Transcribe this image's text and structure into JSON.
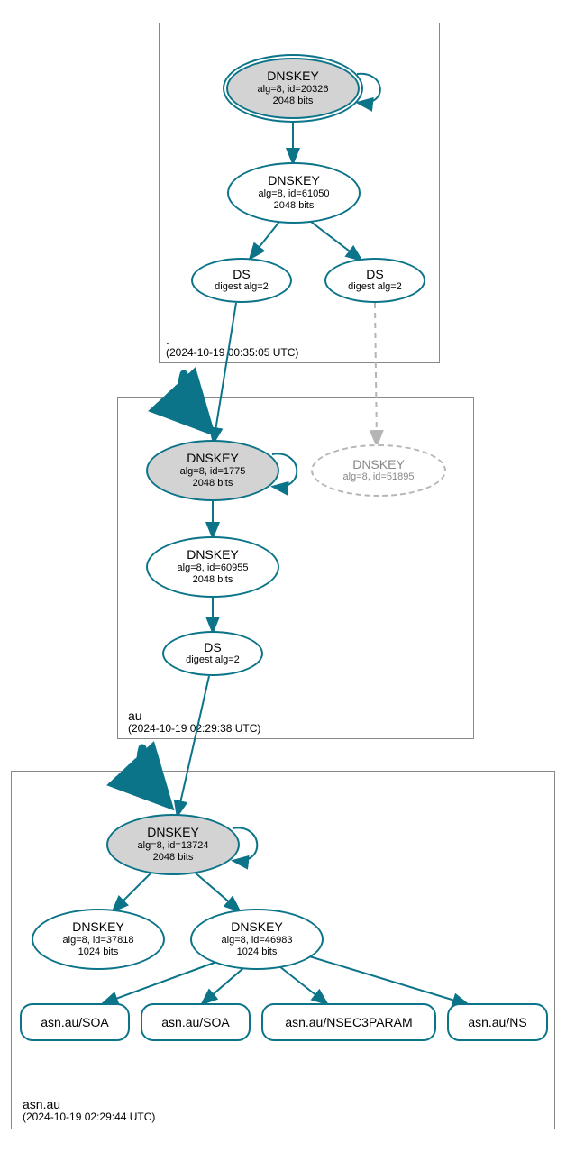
{
  "chart_data": {
    "type": "dag",
    "zones": [
      {
        "name": ".",
        "timestamp": "(2024-10-19 00:35:05 UTC)"
      },
      {
        "name": "au",
        "timestamp": "(2024-10-19 02:29:38 UTC)"
      },
      {
        "name": "asn.au",
        "timestamp": "(2024-10-19 02:29:44 UTC)"
      }
    ],
    "nodes": {
      "root_ksk": {
        "type": "DNSKEY",
        "detail": "alg=8, id=20326",
        "bits": "2048 bits",
        "ksk": true,
        "trust_anchor": true
      },
      "root_zsk": {
        "type": "DNSKEY",
        "detail": "alg=8, id=61050",
        "bits": "2048 bits"
      },
      "root_ds1": {
        "type": "DS",
        "detail": "digest alg=2"
      },
      "root_ds2": {
        "type": "DS",
        "detail": "digest alg=2"
      },
      "au_ksk": {
        "type": "DNSKEY",
        "detail": "alg=8, id=1775",
        "bits": "2048 bits",
        "ksk": true
      },
      "au_zsk": {
        "type": "DNSKEY",
        "detail": "alg=8, id=60955",
        "bits": "2048 bits"
      },
      "au_pre": {
        "type": "DNSKEY",
        "detail": "alg=8, id=51895",
        "dashed": true
      },
      "au_ds": {
        "type": "DS",
        "detail": "digest alg=2"
      },
      "asn_ksk": {
        "type": "DNSKEY",
        "detail": "alg=8, id=13724",
        "bits": "2048 bits",
        "ksk": true
      },
      "asn_zsk1": {
        "type": "DNSKEY",
        "detail": "alg=8, id=37818",
        "bits": "1024 bits"
      },
      "asn_zsk2": {
        "type": "DNSKEY",
        "detail": "alg=8, id=46983",
        "bits": "1024 bits"
      },
      "rr_soa1": {
        "type": "RR",
        "label": "asn.au/SOA"
      },
      "rr_soa2": {
        "type": "RR",
        "label": "asn.au/SOA"
      },
      "rr_nsec3": {
        "type": "RR",
        "label": "asn.au/NSEC3PARAM"
      },
      "rr_ns": {
        "type": "RR",
        "label": "asn.au/NS"
      }
    },
    "edges": [
      [
        "root_ksk",
        "root_ksk",
        "self"
      ],
      [
        "root_ksk",
        "root_zsk",
        "solid"
      ],
      [
        "root_zsk",
        "root_ds1",
        "solid"
      ],
      [
        "root_zsk",
        "root_ds2",
        "solid"
      ],
      [
        "root_ds1",
        "au_ksk",
        "solid"
      ],
      [
        "root_ds2",
        "au_pre",
        "dashed-gray"
      ],
      [
        "au_ksk",
        "au_ksk",
        "self"
      ],
      [
        "au_ksk",
        "au_zsk",
        "solid"
      ],
      [
        "au_zsk",
        "au_ds",
        "solid"
      ],
      [
        "au_ds",
        "asn_ksk",
        "solid"
      ],
      [
        "asn_ksk",
        "asn_ksk",
        "self"
      ],
      [
        "asn_ksk",
        "asn_zsk1",
        "solid"
      ],
      [
        "asn_ksk",
        "asn_zsk2",
        "solid"
      ],
      [
        "asn_zsk2",
        "rr_soa1",
        "solid"
      ],
      [
        "asn_zsk2",
        "rr_soa2",
        "solid"
      ],
      [
        "asn_zsk2",
        "rr_nsec3",
        "solid"
      ],
      [
        "asn_zsk2",
        "rr_ns",
        "solid"
      ]
    ],
    "delegations": [
      [
        ".",
        "au"
      ],
      [
        "au",
        "asn.au"
      ]
    ]
  }
}
